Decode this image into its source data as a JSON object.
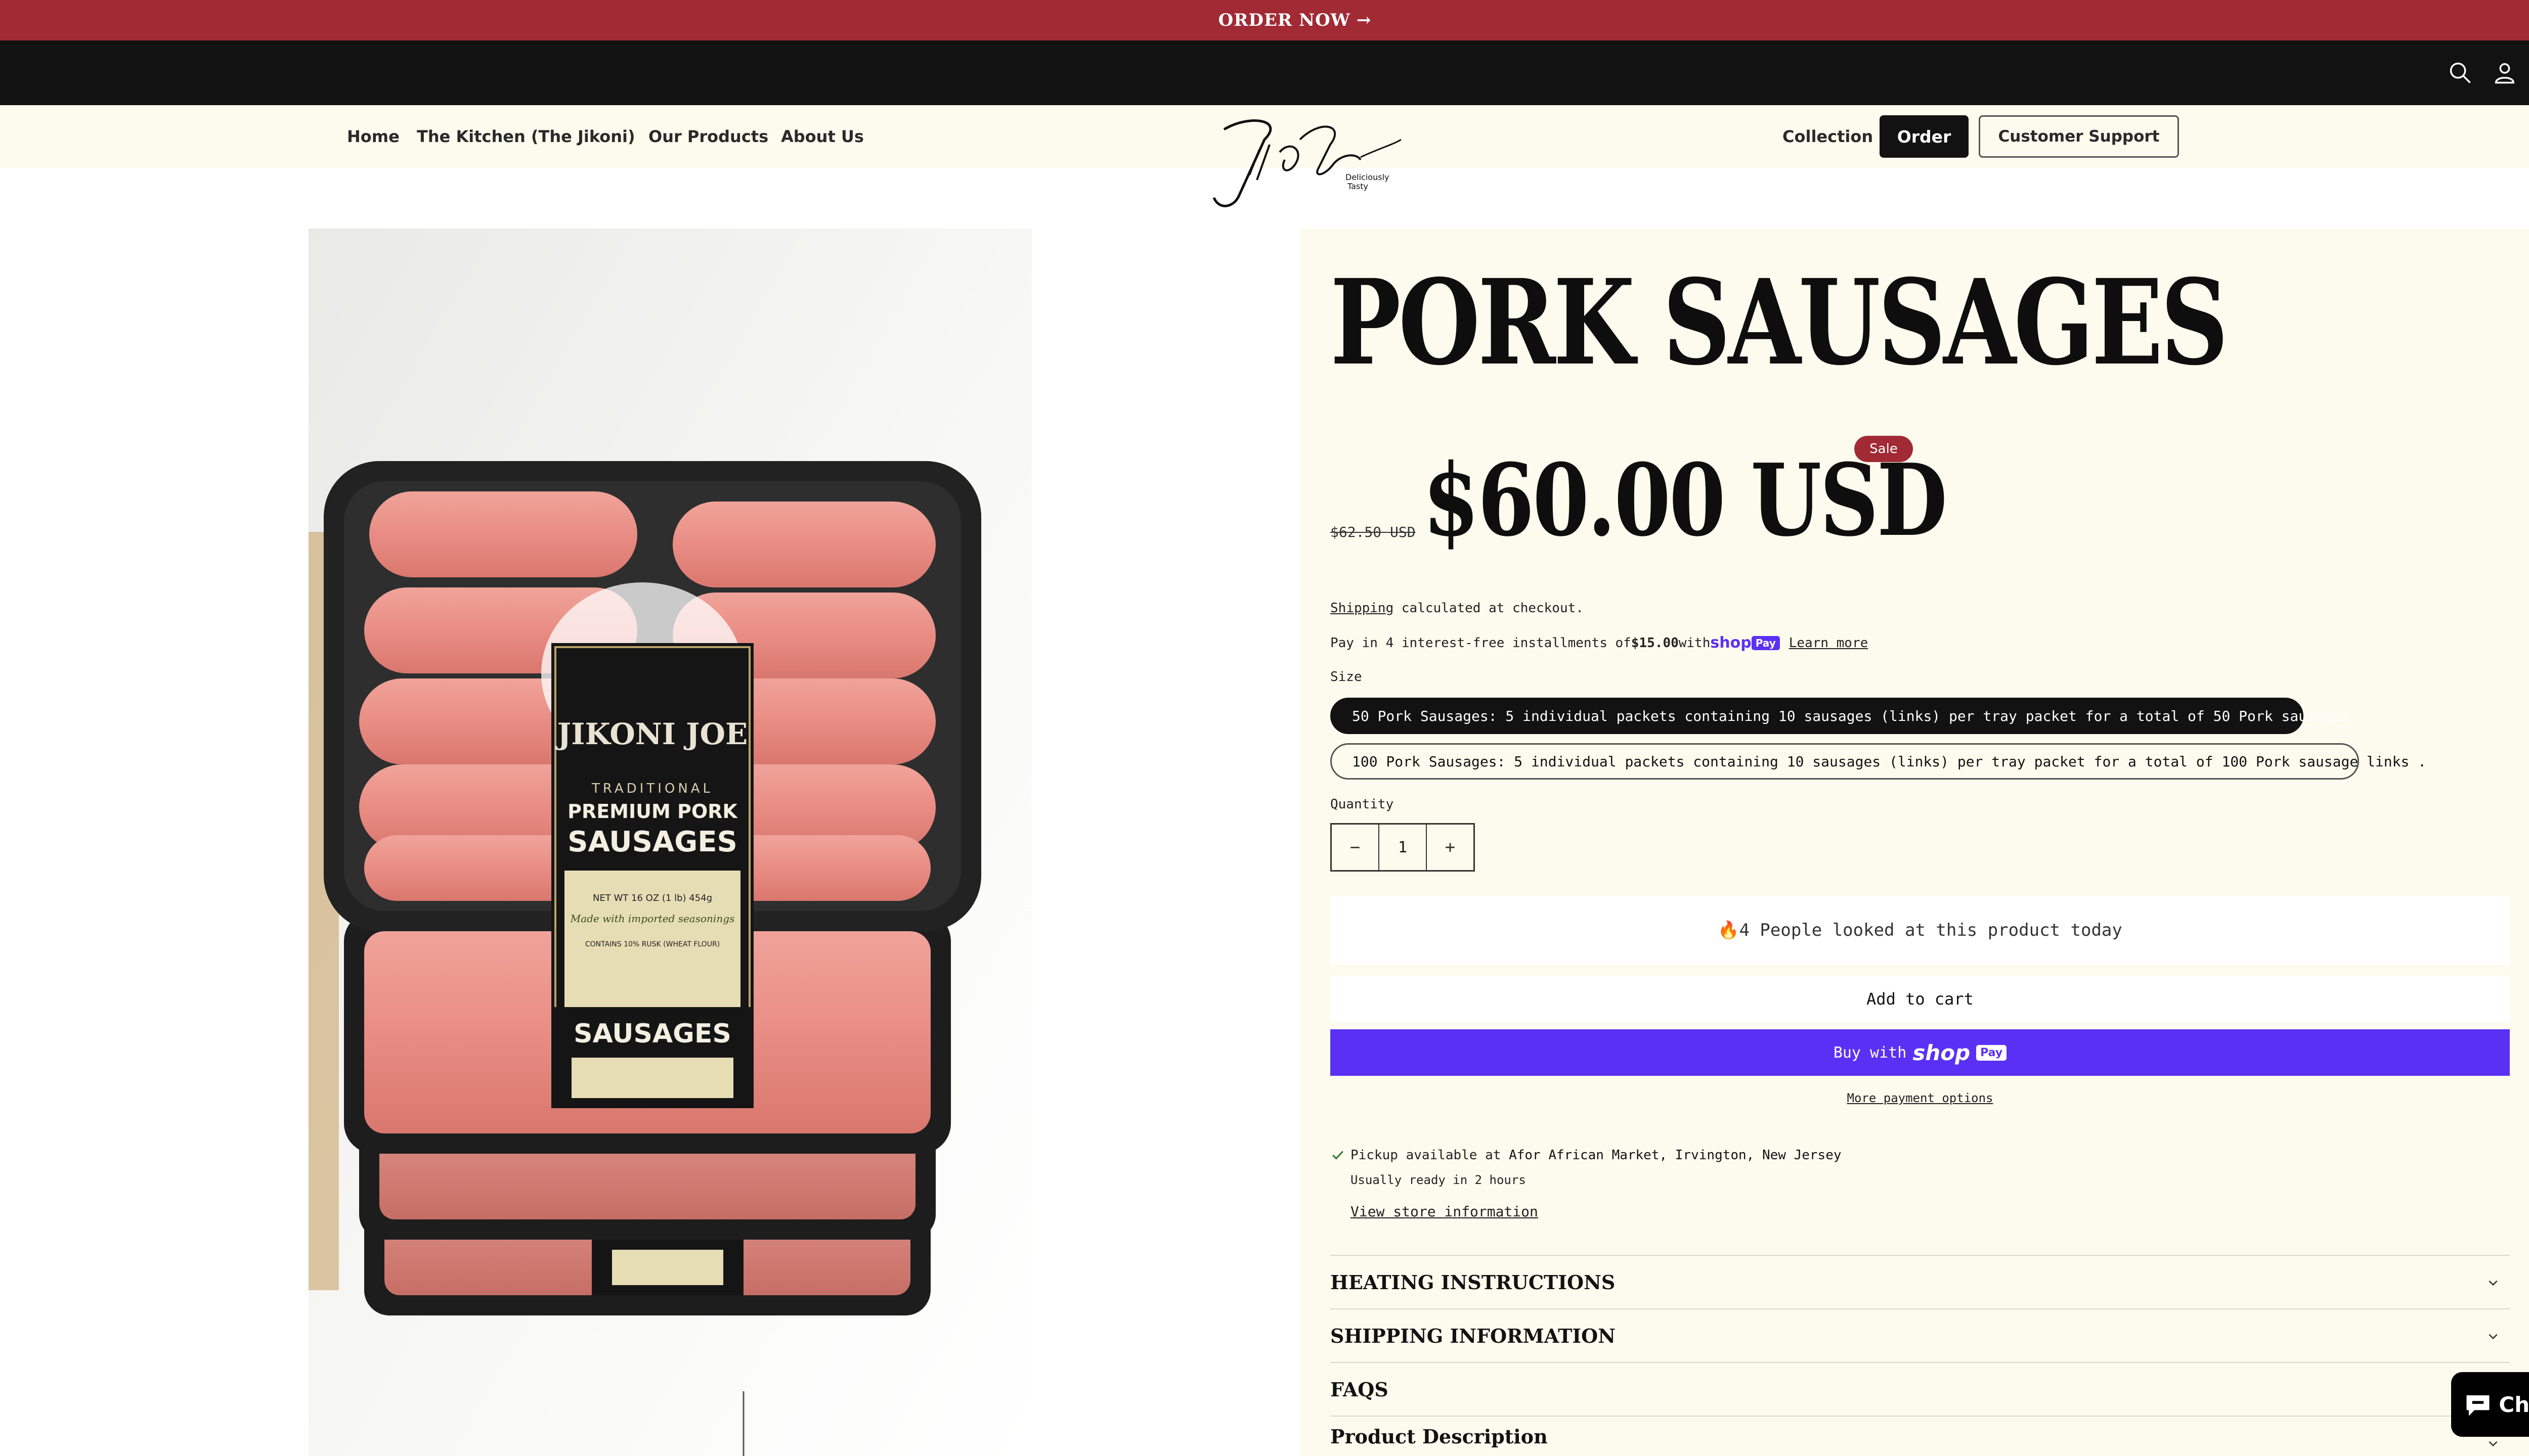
{
  "announcement": {
    "text": "ORDER NOW",
    "arrow": "→"
  },
  "utility_icons": [
    "search-icon",
    "account-icon",
    "cart-icon"
  ],
  "nav": {
    "left": [
      "Home",
      "The Kitchen (The Jikoni)",
      "Our Products",
      "About Us"
    ],
    "collection": "Collection",
    "order": "Order",
    "support": "Customer Support"
  },
  "logo": {
    "script": "JikoniJoe",
    "tagline_1": "Deliciously",
    "tagline_2": "Tasty"
  },
  "product_image": {
    "label_brand": "JIKONI JOE",
    "label_traditional": "TRADITIONAL",
    "label_premium": "PREMIUM PORK",
    "label_sausages": "SAUSAGES",
    "label_weight": "NET WT 16 OZ (1 lb) 454g",
    "label_imported": "Made with imported seasonings",
    "label_rusk": "CONTAINS 10% RUSK (WHEAT FLOUR)"
  },
  "product": {
    "title": "PORK SAUSAGES",
    "price_old": "$62.50 USD",
    "price_new": "$60.00 USD",
    "sale_badge": "Sale",
    "shipping_link": "Shipping",
    "shipping_rest": " calculated at checkout.",
    "installments_pre": "Pay in 4 interest-free installments of ",
    "installments_amount": "$15.00",
    "installments_with": " with ",
    "shop_word": "shop",
    "pay_word": "Pay",
    "learn_more": "Learn more",
    "size_label": "Size",
    "variants": [
      "50 Pork Sausages: 5 individual packets containing 10 sausages (links) per tray packet for a total of 50 Pork sausages.",
      "100 Pork Sausages: 5 individual packets containing 10 sausages (links) per tray packet for a total of 100 Pork sausage links ."
    ],
    "selected_variant": 0,
    "quantity_label": "Quantity",
    "quantity": "1",
    "qty_minus": "−",
    "qty_plus": "+",
    "viewers_icon": "🔥",
    "viewers_text": "4 People looked at this product today",
    "add_to_cart": "Add to cart",
    "buy_with": "Buy with",
    "more_payment": "More payment options",
    "pickup_pre": "Pickup available at ",
    "pickup_location": "Afor African Market, Irvington, New Jersey",
    "pickup_ready": "Usually ready in 2 hours",
    "view_store": "View store information",
    "accordions": [
      "HEATING INSTRUCTIONS",
      "SHIPPING INFORMATION",
      "FAQS",
      "Product Description"
    ]
  },
  "chat": {
    "label": "Chat"
  },
  "colors": {
    "brand_red": "#a12a35",
    "shop_pay": "#5a31f4",
    "cream": "#fdfbee",
    "black": "#121212"
  }
}
